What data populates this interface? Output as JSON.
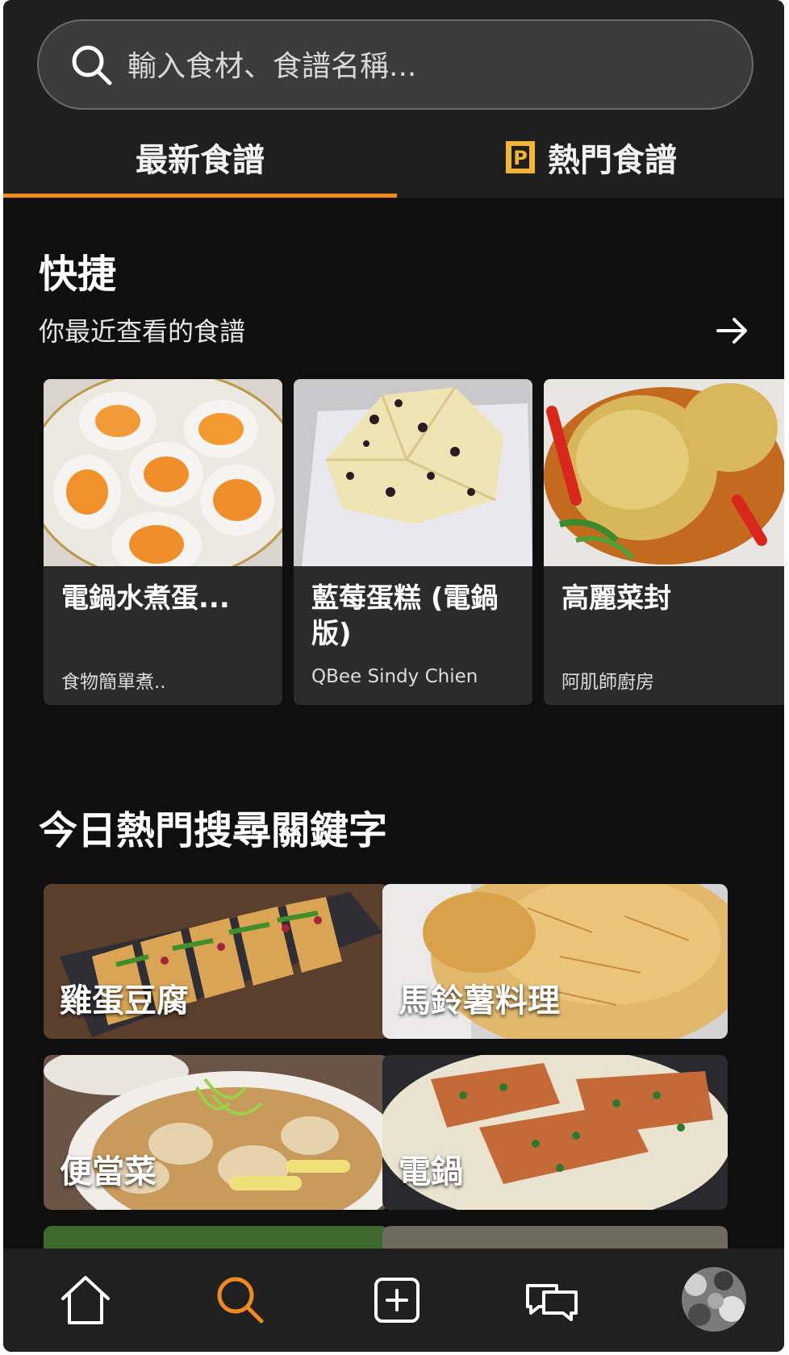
{
  "search": {
    "placeholder": "輸入食材、食譜名稱..."
  },
  "tabs": [
    {
      "label": "最新食譜"
    },
    {
      "label": "熱門食譜"
    }
  ],
  "colors": {
    "accent": "#f0891e",
    "background": "#0f0f0f",
    "header": "#1f1f1f",
    "card": "#2b2b2b",
    "pin": "#f2b632"
  },
  "quick": {
    "title": "快捷",
    "recent_label": "你最近查看的食譜",
    "recipes": [
      {
        "title": "電鍋水煮蛋...",
        "author": "食物簡單煮.."
      },
      {
        "title": "藍莓蛋糕 (電鍋版)",
        "author": "QBee Sindy Chien"
      },
      {
        "title": "高麗菜封",
        "author": "阿肌師廚房"
      }
    ]
  },
  "trending": {
    "title": "今日熱門搜尋關鍵字",
    "keywords": [
      {
        "label": "雞蛋豆腐"
      },
      {
        "label": "馬鈴薯料理"
      },
      {
        "label": "便當菜"
      },
      {
        "label": "電鍋"
      }
    ]
  },
  "nav": {
    "items": [
      {
        "icon": "home-icon"
      },
      {
        "icon": "search-icon",
        "active": true
      },
      {
        "icon": "add-icon"
      },
      {
        "icon": "chat-icon"
      },
      {
        "icon": "avatar"
      }
    ]
  }
}
